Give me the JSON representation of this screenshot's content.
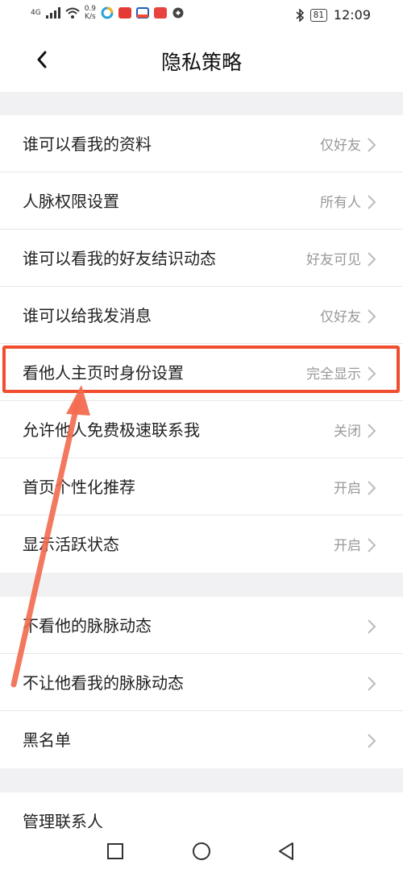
{
  "status_bar": {
    "network": "4G",
    "speed_value": "0.9",
    "speed_unit": "K/s",
    "battery": "81",
    "time": "12:09"
  },
  "header": {
    "title": "隐私策略"
  },
  "group1": [
    {
      "label": "谁可以看我的资料",
      "value": "仅好友"
    },
    {
      "label": "人脉权限设置",
      "value": "所有人"
    },
    {
      "label": "谁可以看我的好友结识动态",
      "value": "好友可见"
    },
    {
      "label": "谁可以给我发消息",
      "value": "仅好友"
    },
    {
      "label": "看他人主页时身份设置",
      "value": "完全显示"
    },
    {
      "label": "允许他人免费极速联系我",
      "value": "关闭"
    },
    {
      "label": "首页个性化推荐",
      "value": "开启"
    },
    {
      "label": "显示活跃状态",
      "value": "开启"
    }
  ],
  "group2": [
    {
      "label": "不看他的脉脉动态"
    },
    {
      "label": "不让他看我的脉脉动态"
    },
    {
      "label": "黑名单"
    }
  ],
  "group3": [
    {
      "label": "管理联系人"
    }
  ],
  "colors": {
    "highlight": "#f04e2f",
    "arrow": "#f26a4f"
  }
}
